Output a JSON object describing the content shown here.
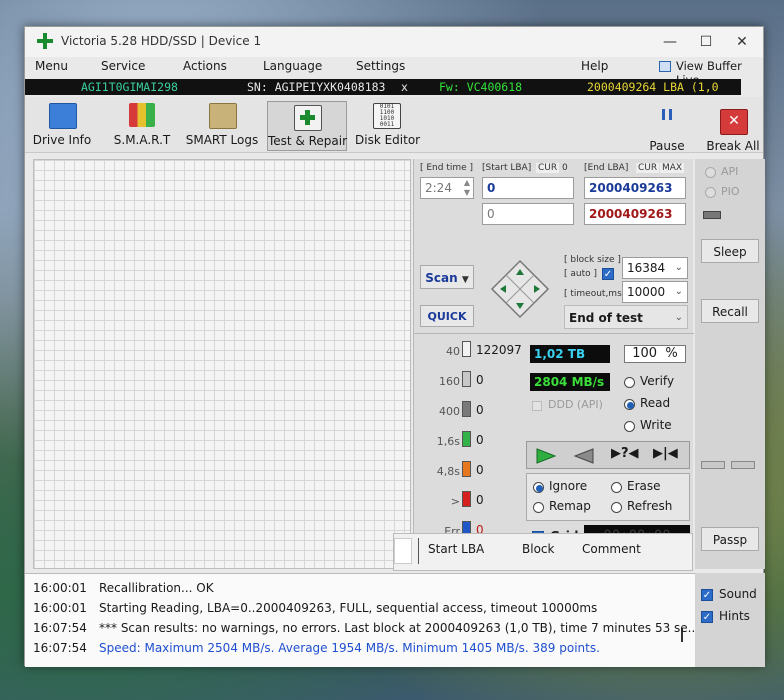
{
  "window": {
    "title": "Victoria 5.28 HDD/SSD | Device 1"
  },
  "menu": {
    "items": [
      "Menu",
      "Service",
      "Actions",
      "Language",
      "Settings",
      "Help"
    ],
    "view_buffer": "View Buffer Live"
  },
  "infobar": {
    "model": "AGI1T0GIMAI298",
    "serial": "SN: AGIPEIYXK0408183",
    "close": "x",
    "firmware": "Fw: VC400618",
    "lba": "2000409264 LBA (1,0 TB)"
  },
  "toolbar": {
    "drive_info": "Drive Info",
    "smart": "S.M.A.R.T",
    "smart_logs": "SMART Logs",
    "test_repair": "Test & Repair",
    "disk_editor": "Disk Editor",
    "pause": "Pause",
    "break_all": "Break All"
  },
  "test": {
    "end_time_label": "[ End time ]",
    "end_time_value": "2:24",
    "start_lba_label": "[Start LBA]",
    "cur": "CUR",
    "start_cur": "0",
    "start_lba_value": "0",
    "start_lba_value2": "0",
    "end_lba_label": "[End LBA]",
    "max": "MAX",
    "end_lba_value": "2000409263",
    "end_lba_value2": "2000409263",
    "scan": "Scan",
    "quick": "QUICK",
    "block_size_label": "[ block size ]",
    "auto_label": "[ auto ]",
    "block_size_value": "16384",
    "timeout_label": "[ timeout,ms ]",
    "timeout_value": "10000",
    "end_of_test": "End of test"
  },
  "stats": {
    "rows": [
      {
        "label": "40",
        "count": "122097",
        "color": "#f2f2f2"
      },
      {
        "label": "160",
        "count": "0",
        "color": "#c8c8c8"
      },
      {
        "label": "400",
        "count": "0",
        "color": "#7a7a7a"
      },
      {
        "label": "1,6s",
        "count": "0",
        "color": "#33b24a"
      },
      {
        "label": "4,8s",
        "count": "0",
        "color": "#e8781e"
      },
      {
        "label": ">",
        "count": "0",
        "color": "#d62020"
      },
      {
        "label": "Err",
        "count": "0",
        "color": "#1f57c9"
      }
    ],
    "total_tb": "1,02 TB",
    "percent": "100",
    "percent_sign": "%",
    "speed": "2804 MB/s",
    "verify": "Verify",
    "read": "Read",
    "write": "Write",
    "ddd": "DDD (API)",
    "ignore": "Ignore",
    "erase": "Erase",
    "remap": "Remap",
    "refresh": "Refresh",
    "grid": "Grid",
    "timer": "00:00:00",
    "col_start": "Start LBA",
    "col_block": "Block",
    "col_comment": "Comment"
  },
  "side": {
    "api": "API",
    "pio": "PIO",
    "sleep": "Sleep",
    "recall": "Recall",
    "passp": "Passp",
    "sound": "Sound",
    "hints": "Hints"
  },
  "log": [
    {
      "time": "16:00:01",
      "text": "Recallibration... OK",
      "color": "#1a1a1a"
    },
    {
      "time": "16:00:01",
      "text": "Starting Reading, LBA=0..2000409263, FULL, sequential access, timeout 10000ms",
      "color": "#1a1a1a"
    },
    {
      "time": "16:07:54",
      "text": "*** Scan results: no warnings, no errors. Last block at 2000409263 (1,0 TB), time 7 minutes 53 se...",
      "color": "#1a1a1a"
    },
    {
      "time": "16:07:54",
      "text": "Speed: Maximum 2504 MB/s. Average 1954 MB/s. Minimum 1405 MB/s. 389 points.",
      "color": "#1f4fd0"
    }
  ]
}
